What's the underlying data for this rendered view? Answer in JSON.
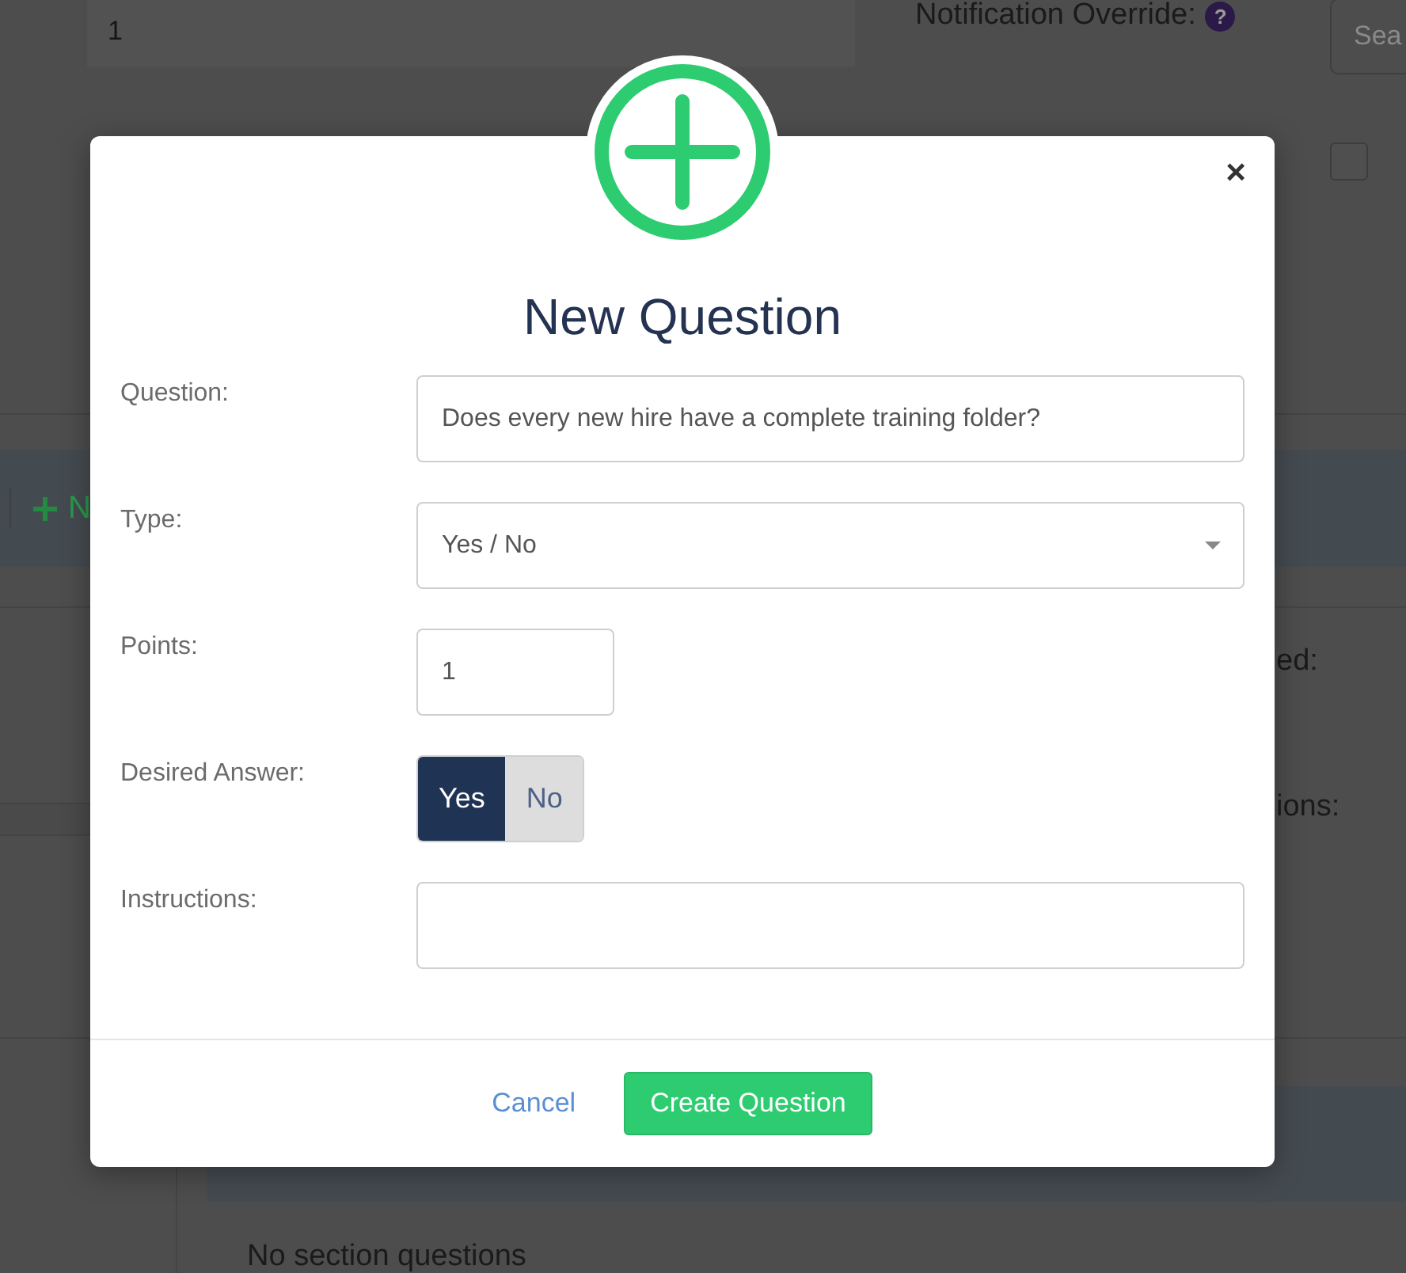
{
  "background": {
    "top_field": {
      "value": "1"
    },
    "notification": {
      "label": "Notification Override:",
      "help": "?"
    },
    "search_field": {
      "placeholder": "Sea"
    },
    "checkbox": {
      "checked": false
    },
    "toolbar": {
      "button": "N"
    },
    "side_labels": [
      "ed:",
      "ions:"
    ],
    "section": {
      "empty_message": "No section questions"
    }
  },
  "dialog": {
    "close": "×",
    "title": "New Question",
    "fields": [
      {
        "label": "Question:",
        "kind": "text",
        "value": "Does every new hire have a complete training folder?"
      },
      {
        "label": "Type:",
        "kind": "select",
        "value": "Yes / No"
      },
      {
        "label": "Points:",
        "kind": "number",
        "value": "1"
      },
      {
        "label": "Desired Answer:",
        "kind": "toggle",
        "options": [
          {
            "label": "Yes",
            "selected": true
          },
          {
            "label": "No",
            "selected": false
          }
        ]
      },
      {
        "label": "Instructions:",
        "kind": "textarea"
      }
    ],
    "buttons": [
      {
        "label": "Cancel",
        "kind": "link"
      },
      {
        "label": "Create Question",
        "kind": "primary"
      }
    ]
  }
}
